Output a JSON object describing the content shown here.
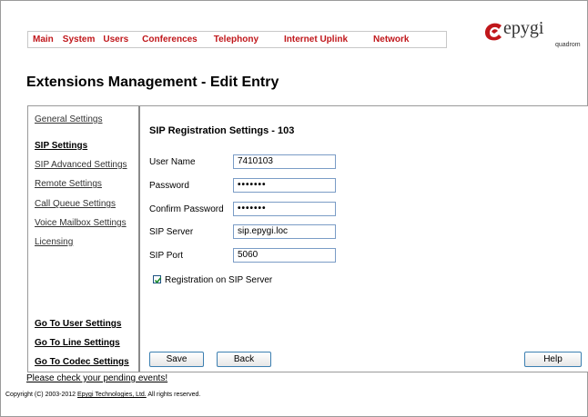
{
  "nav": {
    "items": [
      "Main",
      "System",
      "Users",
      "Conferences",
      "Telephony",
      "Internet Uplink",
      "Network"
    ]
  },
  "logo": {
    "word": "epygi",
    "sub": "quadrom"
  },
  "page": {
    "title": "Extensions Management - Edit Entry"
  },
  "sidebar": {
    "general": "General Settings",
    "sip": "SIP Settings",
    "sip_advanced": "SIP Advanced Settings",
    "remote": "Remote Settings",
    "call_queue": "Call Queue Settings",
    "voice_mailbox": "Voice Mailbox Settings",
    "licensing": "Licensing",
    "go_user": "Go To User Settings",
    "go_line": "Go To Line Settings",
    "go_codec": "Go To Codec Settings"
  },
  "form": {
    "title": "SIP Registration Settings - 103",
    "user_name_label": "User Name",
    "user_name_value": "7410103",
    "password_label": "Password",
    "password_value": "•••••••",
    "confirm_label": "Confirm Password",
    "confirm_value": "•••••••",
    "server_label": "SIP Server",
    "server_value": "sip.epygi.loc",
    "port_label": "SIP Port",
    "port_value": "5060",
    "registration_label": "Registration on SIP Server",
    "registration_checked": true
  },
  "buttons": {
    "save": "Save",
    "back": "Back",
    "help": "Help"
  },
  "footer": {
    "pending": "Please check your pending events!",
    "copyright_prefix": "Copyright (C) 2003-2012",
    "company": "Epygi Technologies, Ltd.",
    "copyright_suffix": "All rights reserved."
  },
  "colors": {
    "nav_text": "#c0171b",
    "logo_red": "#c0171b",
    "input_border": "#7a9cc6",
    "button_border": "#3c7fb1"
  }
}
